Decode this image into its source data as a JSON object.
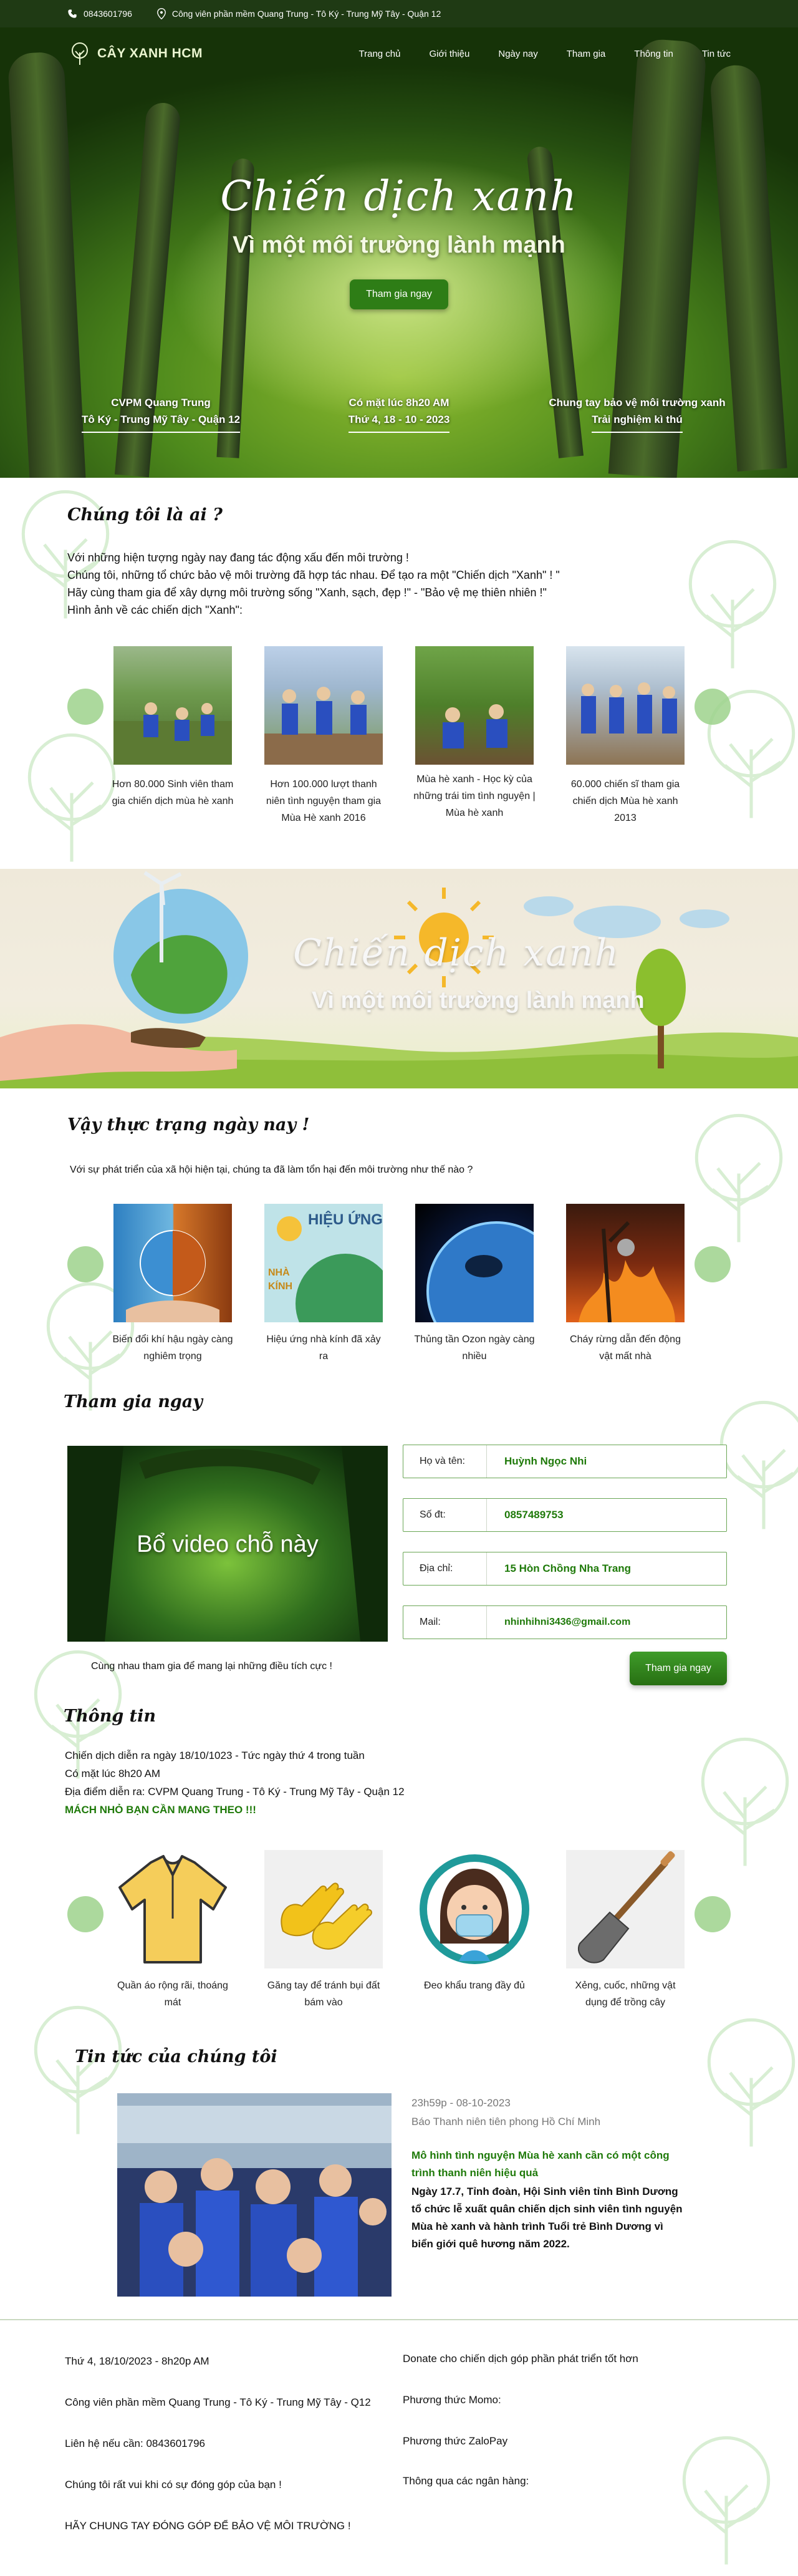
{
  "topbar": {
    "phone": "0843601796",
    "address": "Công viên phần mềm Quang Trung - Tô Ký - Trung Mỹ Tây - Quận 12"
  },
  "nav": {
    "logo_text": "CÂY XANH HCM",
    "items": [
      "Trang chủ",
      "Giới thiệu",
      "Ngày nay",
      "Tham gia",
      "Thông tin",
      "Tin tức"
    ]
  },
  "hero": {
    "title": "Chiến dịch xanh",
    "subtitle": "Vì một môi trường lành mạnh",
    "button": "Tham gia ngay",
    "info": [
      {
        "line1": "CVPM Quang Trung",
        "line2": "Tô Ký - Trung Mỹ Tây - Quận 12"
      },
      {
        "line1": "Có mặt lúc 8h20 AM",
        "line2": "Thứ 4, 18 - 10 - 2023"
      },
      {
        "line1": "Chung tay bảo vệ môi trường xanh",
        "line2": "Trải nghiệm kì thú"
      }
    ]
  },
  "about": {
    "title": "Chúng tôi là ai ?",
    "paragraph": [
      "Với những hiện tượng ngày nay đang tác động xấu đến môi trường !",
      "Chúng tôi, những tổ chức bảo vệ môi trường đã hợp tác nhau. Để tạo ra một \"Chiến dịch \"Xanh\" ! \"",
      "Hãy cùng tham gia để xây dựng môi trường sống \"Xanh, sạch, đẹp !\" - \"Bảo vệ mẹ thiên nhiên !\"",
      "Hình ảnh về các chiến dịch \"Xanh\":"
    ],
    "cards": [
      "Hơn 80.000 Sinh viên tham gia chiến dịch mùa hè xanh",
      "Hơn 100.000 lượt thanh niên tình nguyện tham gia Mùa Hè xanh 2016",
      "Mùa hè xanh - Học kỳ của những trái tim tình nguyện | Mùa hè xanh",
      "60.000 chiến sĩ tham gia chiến dịch Mùa hè xanh 2013"
    ]
  },
  "banner": {
    "title": "Chiến dịch xanh",
    "subtitle": "Vì một môi trường lành mạnh"
  },
  "today": {
    "title": "Vậy thực trạng ngày nay !",
    "intro": "Với sự phát triển của xã hội hiện tại, chúng ta đã làm tổn hại đến môi trường như thế nào ?",
    "img2_text_top": "HIỆU ỨNG",
    "img2_text_bottom": "NHÀ KÍNH",
    "cards": [
      "Biến đổi khí hậu ngày càng nghiêm trọng",
      "Hiệu ứng nhà kính đã xảy ra",
      "Thủng tần Ozon ngày càng nhiều",
      "Cháy rừng dẫn đến động vật mất nhà"
    ]
  },
  "join": {
    "title": "Tham gia ngay",
    "video_text": "Bổ video chỗ này",
    "fields": [
      {
        "label": "Họ và tên:",
        "value": "Huỳnh Ngọc Nhi"
      },
      {
        "label": "Số đt:",
        "value": "0857489753"
      },
      {
        "label": "Địa chỉ:",
        "value": "15 Hòn Chồng Nha Trang"
      },
      {
        "label": "Mail:",
        "value": "nhinhihni3436@gmail.com"
      }
    ],
    "note": "Cùng nhau tham gia để mang lại những điều tích cực !",
    "button": "Tham gia ngay"
  },
  "info": {
    "title": "Thông tin",
    "lines": [
      "Chiến dịch diễn ra ngày 18/10/1023 - Tức ngày thứ 4 trong tuần",
      "Có mặt lúc 8h20 AM",
      "Địa điểm diễn ra: CVPM Quang Trung - Tô Ký - Trung Mỹ Tây - Quận 12"
    ],
    "highlight": "MÁCH NHỎ BẠN CẦN MANG THEO !!!",
    "cards": [
      "Quần áo rộng rãi, thoáng mát",
      "Găng tay để tránh bụi đất bám vào",
      "Đeo khẩu trang đầy đủ",
      "Xẻng, cuốc, những vật dụng để trồng cây"
    ]
  },
  "news": {
    "title": "Tin tức của chúng tôi",
    "time": "23h59p - 08-10-2023",
    "source": "Báo Thanh niên tiên phong Hồ Chí Minh",
    "headline": "Mô hình tình nguyện Mùa hè xanh cần có một công trình thanh niên hiệu quả",
    "body": " Ngày 17.7, Tỉnh đoàn, Hội Sinh viên tỉnh Bình Dương tổ chức lễ xuất quân chiến dịch sinh viên tình nguyện Mùa hè xanh và hành trình Tuổi trẻ Bình Dương vì biển giới quê hương năm 2022."
  },
  "footer": {
    "left": [
      "Thứ 4, 18/10/2023 - 8h20p AM",
      "Công viên phần mềm Quang Trung - Tô Ký - Trung Mỹ Tây - Q12",
      "Liên hệ nếu cần: 0843601796",
      "Chúng tôi rất vui khi có sự đóng góp của bạn !",
      "HÃY CHUNG TAY ĐÓNG GÓP ĐỂ BẢO VỆ MÔI TRƯỜNG !"
    ],
    "right": [
      "Donate cho chiến dịch góp phần phát triển tốt hơn",
      "Phương thức Momo:",
      "Phương thức ZaloPay",
      "Thông qua các ngân hàng:"
    ]
  },
  "colors": {
    "accent_green": "#2e7d16",
    "field_text": "#1f7a0a",
    "topbar_bg": "#1f3a14",
    "arrow_circle": "#9ed28c"
  }
}
